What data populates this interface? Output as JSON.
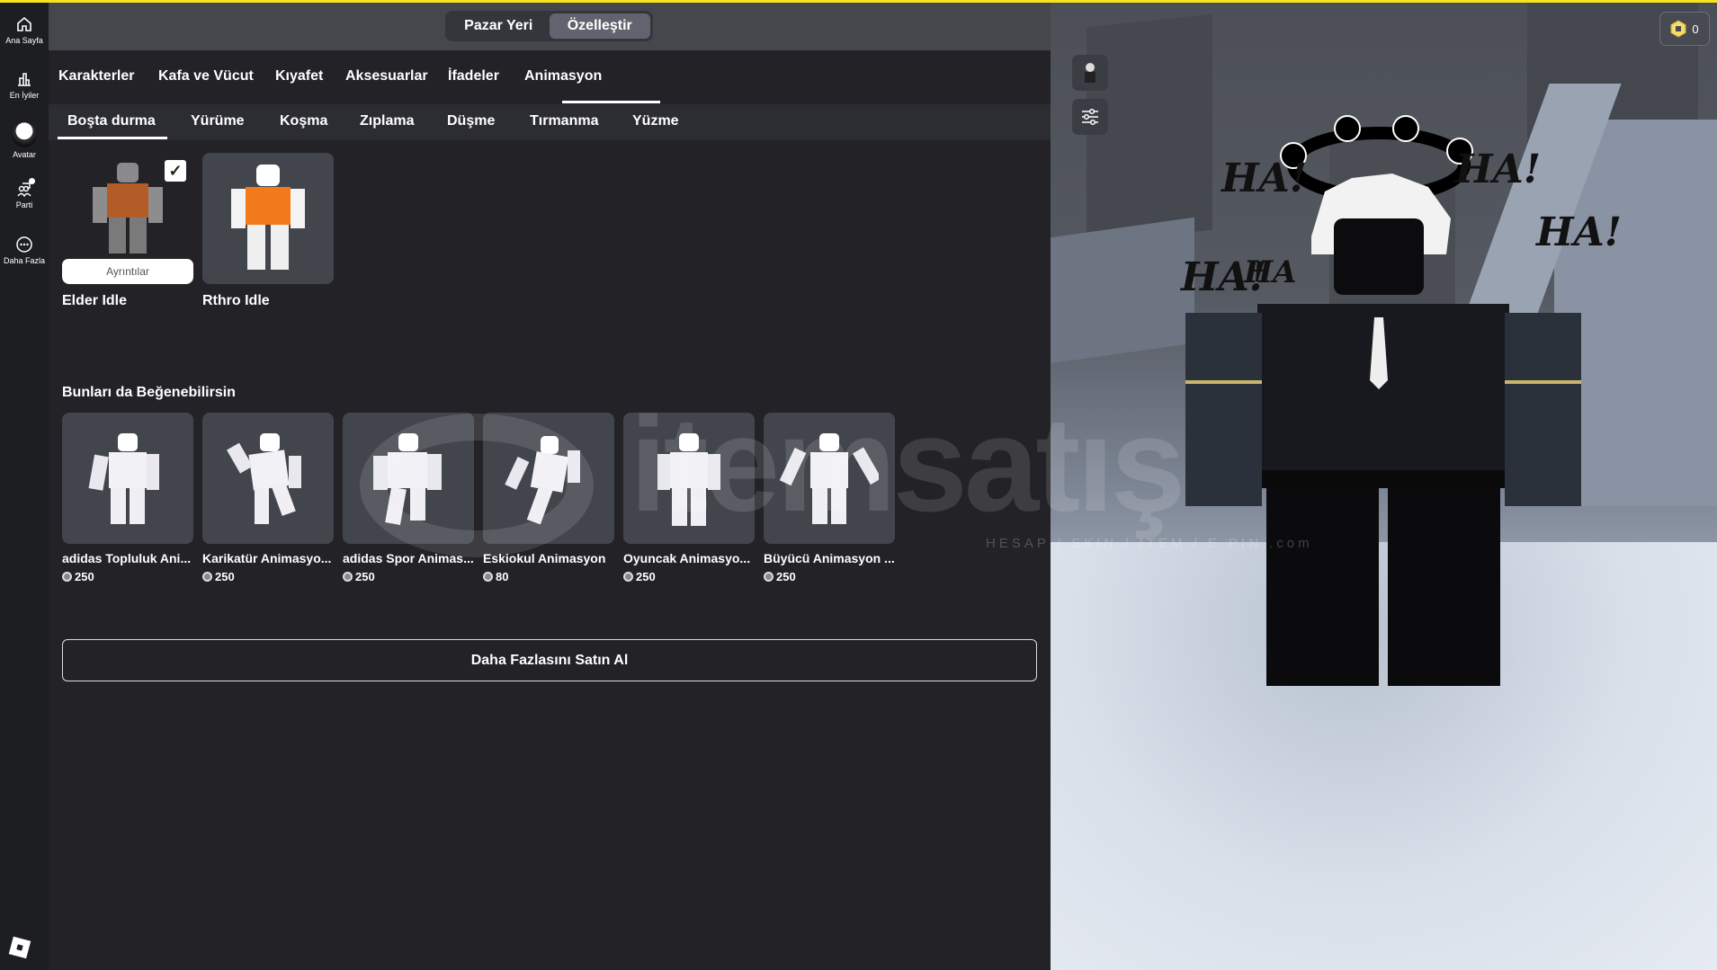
{
  "sidebar": {
    "items": [
      {
        "label": "Ana Sayfa",
        "icon": "home-icon"
      },
      {
        "label": "En İyiler",
        "icon": "chart-icon"
      },
      {
        "label": "Avatar",
        "icon": "avatar-icon"
      },
      {
        "label": "Parti",
        "icon": "party-icon"
      },
      {
        "label": "Daha Fazla",
        "icon": "more-icon"
      }
    ]
  },
  "header": {
    "segments": [
      "Pazar Yeri",
      "Özelleştir"
    ],
    "active": "Özelleştir"
  },
  "categories": [
    "Karakterler",
    "Kafa ve Vücut",
    "Kıyafet",
    "Aksesuarlar",
    "İfadeler",
    "Animasyon"
  ],
  "active_category": "Animasyon",
  "subtabs": [
    "Boşta durma",
    "Yürüme",
    "Koşma",
    "Zıplama",
    "Düşme",
    "Tırmanma",
    "Yüzme"
  ],
  "active_subtab": "Boşta durma",
  "owned": [
    {
      "name": "Elder Idle",
      "selected": true,
      "details_label": "Ayrıntılar"
    },
    {
      "name": "Rthro Idle",
      "selected": false
    }
  ],
  "recommend": {
    "title": "Bunları da Beğenebilirsin",
    "items": [
      {
        "name": "adidas Topluluk Ani...",
        "price": "250"
      },
      {
        "name": "Karikatür Animasyo...",
        "price": "250"
      },
      {
        "name": "adidas Spor Animas...",
        "price": "250"
      },
      {
        "name": "Eskiokul Animasyon",
        "price": "80"
      },
      {
        "name": "Oyuncak Animasyo...",
        "price": "250"
      },
      {
        "name": "Büyücü Animasyon ...",
        "price": "250"
      }
    ]
  },
  "buy_more_label": "Daha Fazlasını Satın Al",
  "robux_balance": "0",
  "watermark": {
    "main": "itemsatış",
    "sub": "HESAP / SKIN / ITEM / E-PIN .com"
  },
  "scene_text": [
    "HA!",
    "HA!",
    "HA!",
    "HA!",
    "HA"
  ],
  "colors": {
    "accent_top": "#f5e51b",
    "panel": "#222227",
    "card": "#43454d"
  }
}
